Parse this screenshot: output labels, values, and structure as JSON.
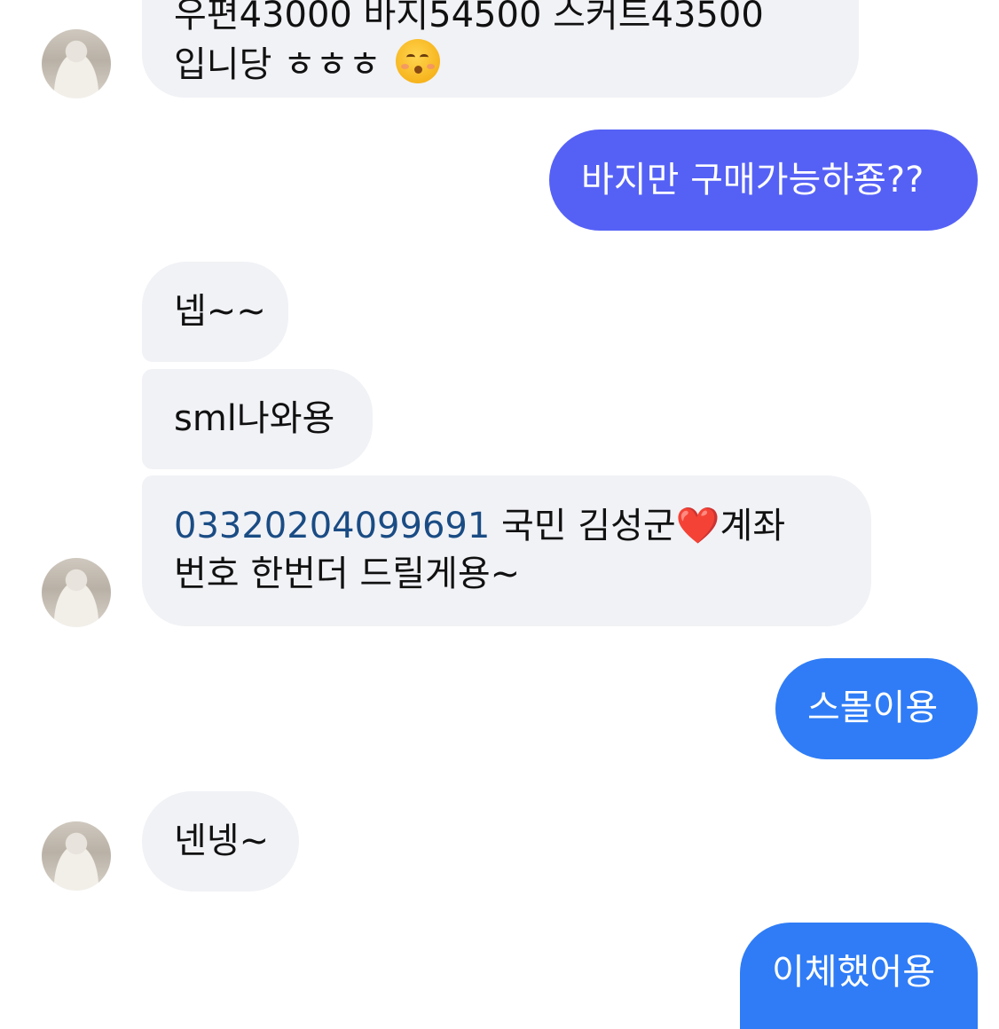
{
  "messages": {
    "m1": {
      "line1": "우편43000 바지54500 스커트43500",
      "line2": "입니당 ㅎㅎㅎ",
      "emoji": "kissing-face-with-closed-eyes"
    },
    "m2": {
      "text": "바지만 구매가능하죵??"
    },
    "m3": {
      "text": "넵~~"
    },
    "m4": {
      "text": "sml나와용"
    },
    "m5": {
      "account": "03320204099691",
      "line1_rest": " 국민 김성군",
      "heart": "❤️",
      "line1_tail": "계좌",
      "line2": "번호 한번더 드릴게용~"
    },
    "m6": {
      "text": "스몰이용"
    },
    "m7": {
      "text": "넨넹~"
    },
    "m8": {
      "text": "이체했어용"
    }
  },
  "colors": {
    "incoming_bubble": "#f1f2f6",
    "outgoing_purple": "#5561f5",
    "outgoing_blue": "#2f7cf6",
    "account_link": "#1a4c84",
    "heart": "#d01010"
  }
}
